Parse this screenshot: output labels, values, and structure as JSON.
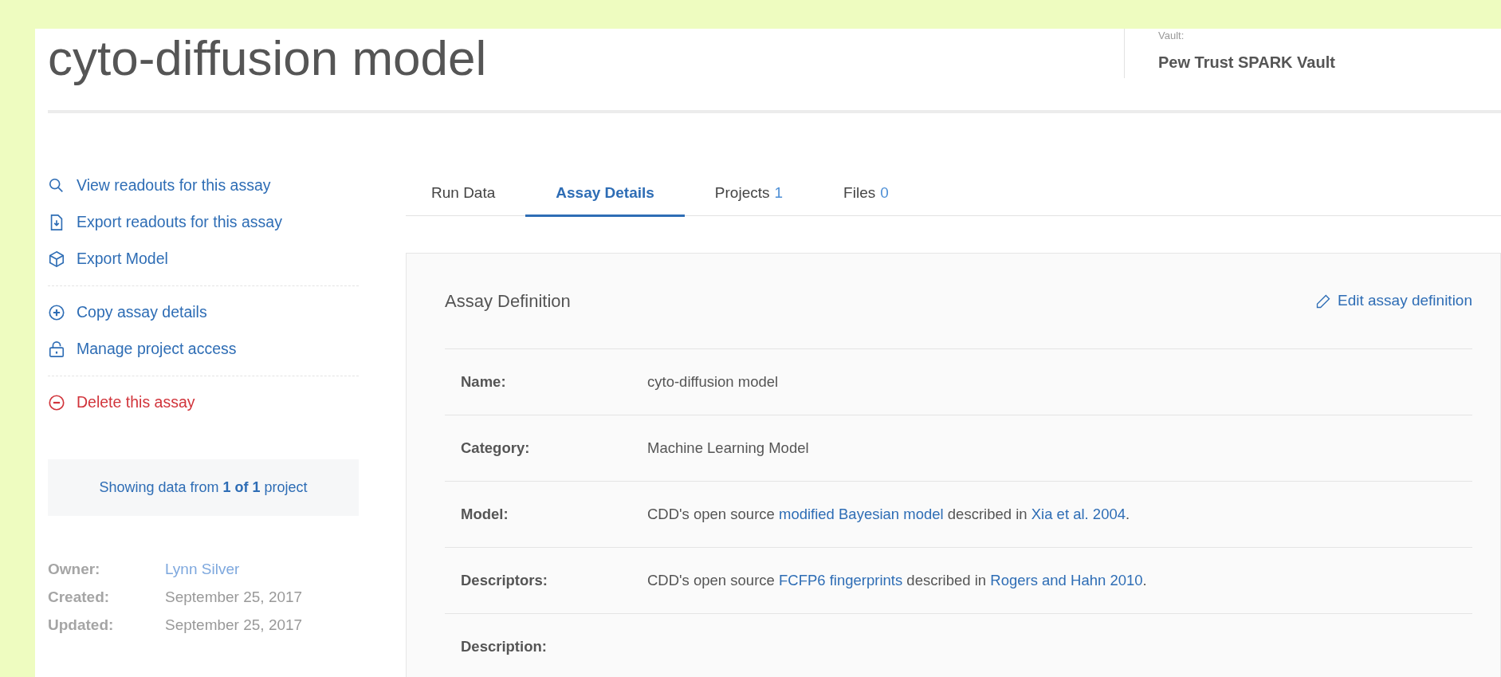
{
  "header": {
    "title": "cyto-diffusion model",
    "vault_label": "Vault:",
    "vault_name": "Pew Trust SPARK Vault"
  },
  "sidebar": {
    "action_groups": [
      [
        {
          "kind": "search",
          "label": "View readouts for this assay"
        },
        {
          "kind": "export",
          "label": "Export readouts for this assay"
        },
        {
          "kind": "model",
          "label": "Export Model"
        }
      ],
      [
        {
          "kind": "copy",
          "label": "Copy assay details"
        },
        {
          "kind": "access",
          "label": "Manage project access"
        }
      ],
      [
        {
          "kind": "delete",
          "label": "Delete this assay"
        }
      ]
    ],
    "summary": "Showing data from **1 of 1** project",
    "meta": [
      {
        "label": "Owner:",
        "value": "Lynn Silver",
        "kind": "link"
      },
      {
        "label": "Created:",
        "value": "September 25, 2017",
        "kind": "text"
      },
      {
        "label": "Updated:",
        "value": "September 25, 2017",
        "kind": "text"
      }
    ]
  },
  "tabs": [
    {
      "label": "Run Data",
      "selected": false
    },
    {
      "label": "Assay Details",
      "selected": true
    },
    {
      "label": "Projects",
      "count": "1",
      "selected": false
    },
    {
      "label": "Files",
      "count": "0",
      "selected": false
    }
  ],
  "definition": {
    "title": "Assay Definition",
    "edit_link": "Edit assay definition",
    "rows": [
      {
        "label": "Name:",
        "parts": [
          {
            "kind": "text",
            "text": "cyto-diffusion model"
          }
        ]
      },
      {
        "label": "Category:",
        "parts": [
          {
            "kind": "text",
            "text": "Machine Learning Model"
          }
        ]
      },
      {
        "label": "Model:",
        "parts": [
          {
            "kind": "text",
            "text": "CDD's open source "
          },
          {
            "kind": "link",
            "text": "modified Bayesian model"
          },
          {
            "kind": "text",
            "text": " described in "
          },
          {
            "kind": "link",
            "text": "Xia et al. 2004"
          },
          {
            "kind": "text",
            "text": "."
          }
        ]
      },
      {
        "label": "Descriptors:",
        "parts": [
          {
            "kind": "text",
            "text": "CDD's open source "
          },
          {
            "kind": "link",
            "text": "FCFP6 fingerprints"
          },
          {
            "kind": "text",
            "text": " described in "
          },
          {
            "kind": "link",
            "text": "Rogers and Hahn 2010"
          },
          {
            "kind": "text",
            "text": "."
          }
        ]
      },
      {
        "label": "Description:"
      }
    ]
  }
}
